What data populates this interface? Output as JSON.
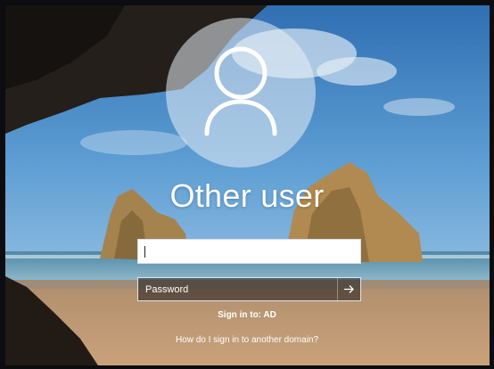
{
  "user": {
    "display_name": "Other user",
    "avatar_icon": "user-silhouette-icon"
  },
  "login": {
    "username_value": "",
    "password_placeholder": "Password",
    "submit_icon": "arrow-right-icon",
    "sign_in_to": "Sign in to: AD",
    "help_link": "How do I sign in to another domain?"
  },
  "colors": {
    "text": "#ffffff",
    "field_background": "#ffffff"
  }
}
